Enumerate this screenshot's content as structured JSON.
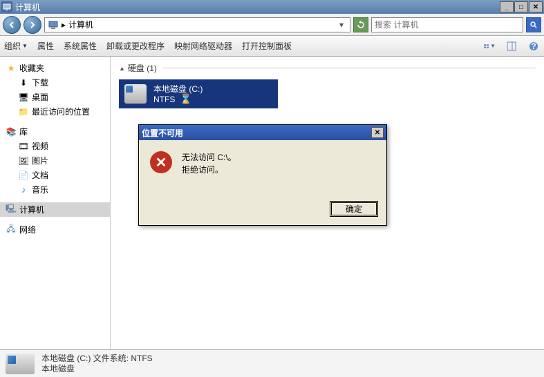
{
  "window": {
    "title": "计算机"
  },
  "nav": {
    "address_prefix": "▸",
    "address": "计算机",
    "search_placeholder": "搜索 计算机"
  },
  "toolbar": {
    "organize": "组织",
    "properties": "属性",
    "sysprops": "系统属性",
    "uninstall": "卸载或更改程序",
    "mapdrive": "映射网络驱动器",
    "controlpanel": "打开控制面板"
  },
  "sidebar": {
    "favorites": "收藏夹",
    "downloads": "下载",
    "desktop": "桌面",
    "recent": "最近访问的位置",
    "libraries": "库",
    "videos": "视频",
    "pictures": "图片",
    "documents": "文档",
    "music": "音乐",
    "computer": "计算机",
    "network": "网络"
  },
  "content": {
    "section": "硬盘 (1)",
    "drive": {
      "name": "本地磁盘 (C:)",
      "fs": "NTFS"
    }
  },
  "dialog": {
    "title": "位置不可用",
    "line1": "无法访问 C:\\。",
    "line2": "拒绝访问。",
    "ok": "确定"
  },
  "status": {
    "line1": "本地磁盘 (C:) 文件系统: NTFS",
    "line2": "本地磁盘"
  }
}
